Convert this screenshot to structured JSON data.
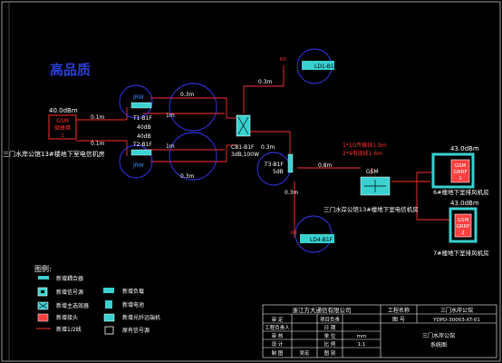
{
  "title": "高品质",
  "source": {
    "label": "三门水岸公馆13#楼地下室电信机房",
    "power": "40.0dBm",
    "unit_line1": "GSM",
    "unit_line2": "微蜂窝",
    "unit_line3": "1",
    "cable_a": "0.1m",
    "cable_b": "0.1m"
  },
  "couplers": {
    "t1_label": "T1-B1F",
    "t1_db1": "40dB",
    "t1_db2": "40dB",
    "t2_label": "T2-B1F",
    "jrw_top": "JRW",
    "jrw_bottom": "JRW",
    "cable_top": "0.3m",
    "cable_bottom": "0.3m",
    "len_1m_a": "1m",
    "len_1m_b": "1m"
  },
  "combiner": {
    "label": "CB1-B1F",
    "sub": "3dB,100W",
    "cable_up": "0.3m",
    "cable_down": "0.3m"
  },
  "splitter_t3": {
    "label": "T3-B1F",
    "sub": "5dB",
    "cable_right": "0.8m",
    "cable_down": "0.3m"
  },
  "antennas": {
    "ld1_tag": "RX",
    "ld1": "LD1-B1F",
    "ld4_tag": "RX",
    "ld4": "LD4-B1F"
  },
  "repeater": {
    "note1": "1*1G传输线1.9m",
    "note2": "2*4电缆线1.6m",
    "label": "GSM",
    "room": "三门水岸公馆13#楼地下室电信机房"
  },
  "right_units": [
    {
      "power": "43.0dBm",
      "l1": "GSM",
      "l2": "GRRF",
      "l3": "1",
      "room": "6#楼地下室排风机房"
    },
    {
      "power": "43.0dBm",
      "l1": "GSM",
      "l2": "GRRF",
      "l3": "2",
      "room": "7#楼地下室排风机房"
    }
  ],
  "legend": {
    "title": "图例:",
    "items": [
      {
        "symbol": "coupler",
        "label": "新增耦合器"
      },
      {
        "symbol": "source",
        "label": "新增信号源"
      },
      {
        "symbol": "combiner",
        "label": "新增主选效器"
      },
      {
        "symbol": "connector",
        "label": "新增接头"
      },
      {
        "symbol": "cable",
        "label": "新增1/2线"
      },
      {
        "symbol": "load",
        "label": "新增负载"
      },
      {
        "symbol": "battery",
        "label": "新增电池"
      },
      {
        "symbol": "pole",
        "label": "新增光纤远端机"
      },
      {
        "symbol": "existing",
        "label": "原有信号源"
      }
    ]
  },
  "title_block": {
    "company": "浙江方大通信有限公司",
    "project_label": "工程名称",
    "project_value": "三门水岸公馆",
    "drawing_no_label": "图 号",
    "drawing_no": "YDPD-30003-XT-01",
    "r1": [
      "审 定",
      "",
      "项目负责",
      ""
    ],
    "r2": [
      "工程负责人",
      "",
      "日 期",
      ""
    ],
    "r3": [
      "审 核",
      "",
      "单 位",
      "mm"
    ],
    "r4": [
      "设 计",
      "",
      "比 例",
      "1:1"
    ],
    "r5": [
      "制 图",
      "吴宏",
      "图 别",
      ""
    ],
    "drawing_title_1": "三门水岸公馆",
    "drawing_title_2": "系统图"
  }
}
